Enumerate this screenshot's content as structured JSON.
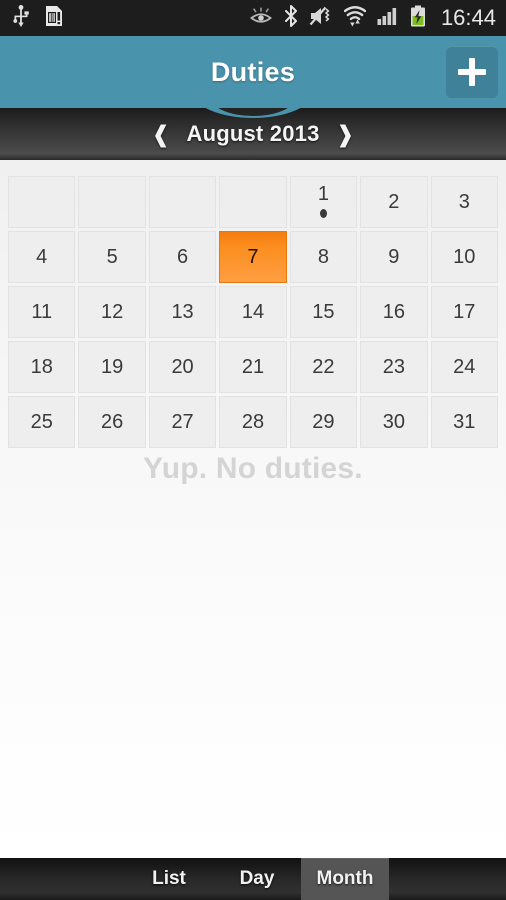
{
  "status_bar": {
    "time": "16:44",
    "left_icons": [
      "usb-icon",
      "sd-card-icon"
    ],
    "right_icons": [
      "eye-icon",
      "bluetooth-icon",
      "mute-vibrate-icon",
      "wifi-icon",
      "signal-icon",
      "battery-charging-icon"
    ]
  },
  "title_bar": {
    "title": "Duties",
    "add_label": "+",
    "accent_color": "#4a93ac",
    "add_button_color": "#3e8199"
  },
  "month_nav": {
    "prev_label": "❰",
    "next_label": "❱",
    "month_label": "August 2013"
  },
  "calendar": {
    "weeks": [
      [
        {
          "day": "",
          "empty": true
        },
        {
          "day": "",
          "empty": true
        },
        {
          "day": "",
          "empty": true
        },
        {
          "day": "",
          "empty": true
        },
        {
          "day": "1",
          "dot": true
        },
        {
          "day": "2"
        },
        {
          "day": "3"
        }
      ],
      [
        {
          "day": "4"
        },
        {
          "day": "5"
        },
        {
          "day": "6"
        },
        {
          "day": "7",
          "selected": true
        },
        {
          "day": "8"
        },
        {
          "day": "9"
        },
        {
          "day": "10"
        }
      ],
      [
        {
          "day": "11"
        },
        {
          "day": "12"
        },
        {
          "day": "13"
        },
        {
          "day": "14"
        },
        {
          "day": "15"
        },
        {
          "day": "16"
        },
        {
          "day": "17"
        }
      ],
      [
        {
          "day": "18"
        },
        {
          "day": "19"
        },
        {
          "day": "20"
        },
        {
          "day": "21"
        },
        {
          "day": "22"
        },
        {
          "day": "23"
        },
        {
          "day": "24"
        }
      ],
      [
        {
          "day": "25"
        },
        {
          "day": "26"
        },
        {
          "day": "27"
        },
        {
          "day": "28"
        },
        {
          "day": "29"
        },
        {
          "day": "30"
        },
        {
          "day": "31"
        }
      ]
    ],
    "selected_color": "#fb8e1e",
    "cell_color": "#eeeeee"
  },
  "main": {
    "empty_message": "Yup. No duties."
  },
  "tab_bar": {
    "tabs": [
      {
        "label": "List",
        "active": false
      },
      {
        "label": "Day",
        "active": false
      },
      {
        "label": "Month",
        "active": true
      }
    ],
    "active_color": "#555555"
  }
}
